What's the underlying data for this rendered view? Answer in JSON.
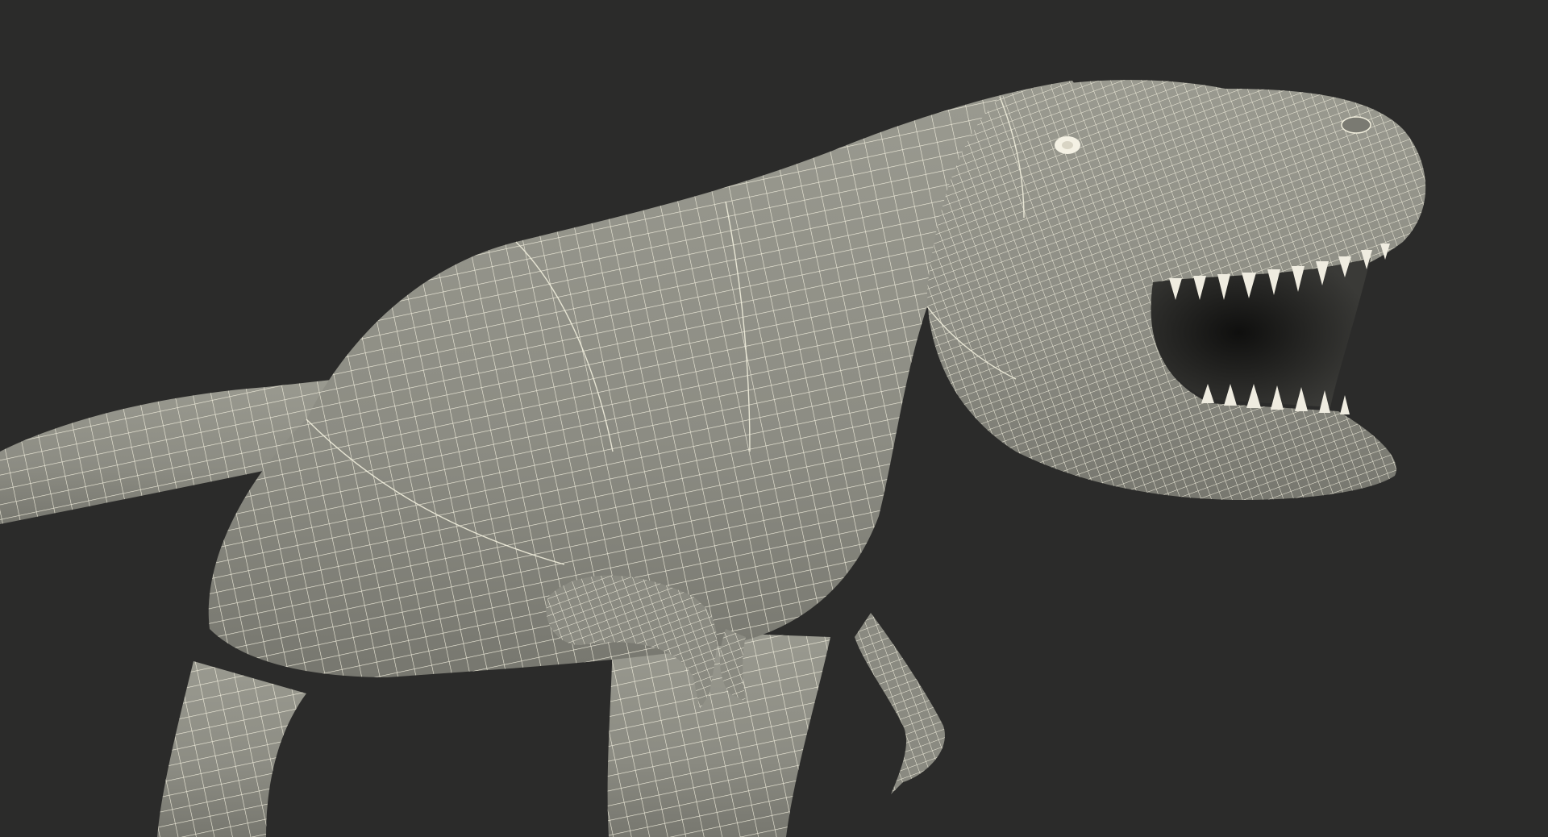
{
  "scene": {
    "background_color": "#2b2b2a",
    "model_fill_color": "#8f8f86",
    "model_shadow_color": "#6e6e66",
    "wire_color": "#f1eedd",
    "mouth_color": "#1a1a18"
  }
}
